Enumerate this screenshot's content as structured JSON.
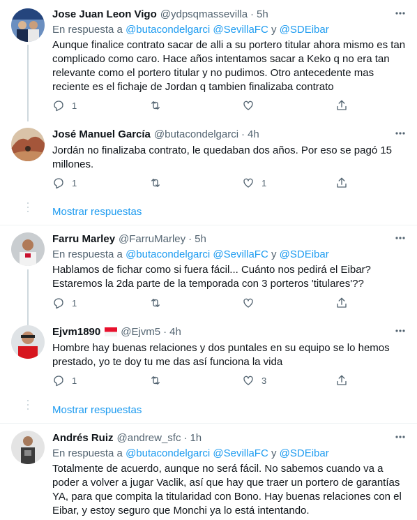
{
  "colors": {
    "link": "#1d9bf0",
    "muted": "#536471",
    "text": "#0f1419",
    "line": "#cfd9de"
  },
  "reply_prefix": "En respuesta a",
  "reply_and": "y",
  "show_replies": "Mostrar respuestas",
  "tweets": [
    {
      "name": "Jose Juan Leon Vigo",
      "handle": "@ydpsqmassevilla",
      "dot": "·",
      "time": "5h",
      "mentions": [
        "@butacondelgarci",
        "@SevillaFC",
        "@SDEibar"
      ],
      "text": [
        "Aunque finalice contrato sacar de alli a su portero titular ahora mismo es tan",
        "complicado como caro. Hace años intentamos sacar a Keko q no era tan",
        "relevante como el portero titular y no pudimos. Otro antecedente mas",
        "reciente es el fichaje de Jordan q tambien finalizaba contrato"
      ],
      "replies": "1",
      "retweets": "",
      "likes": ""
    },
    {
      "name": "José Manuel García",
      "handle": "@butacondelgarci",
      "dot": "·",
      "time": "4h",
      "text": [
        "Jordán no finalizaba contrato, le quedaban dos años. Por eso se pagó 15",
        "millones."
      ],
      "replies": "1",
      "retweets": "",
      "likes": "1"
    },
    {
      "name": "Farru Marley",
      "handle": "@FarruMarley",
      "dot": "·",
      "time": "5h",
      "mentions": [
        "@butacondelgarci",
        "@SevillaFC",
        "@SDEibar"
      ],
      "text": [
        "Hablamos de fichar como si fuera fácil... Cuánto nos pedirá el Eibar?",
        "Estaremos la 2da parte de la temporada con 3 porteros 'titulares'??"
      ],
      "replies": "1",
      "retweets": "",
      "likes": ""
    },
    {
      "name": "Ejvm1890",
      "handle": "@Ejvm5",
      "dot": "·",
      "time": "4h",
      "text": [
        "Hombre hay buenas relaciones y dos puntales en su equipo se lo hemos",
        "prestado, yo te doy tu me das así funciona la vida"
      ],
      "replies": "1",
      "retweets": "",
      "likes": "3"
    },
    {
      "name": "Andrés Ruiz",
      "handle": "@andrew_sfc",
      "dot": "·",
      "time": "1h",
      "mentions": [
        "@butacondelgarci",
        "@SevillaFC",
        "@SDEibar"
      ],
      "text": [
        "Totalmente de acuerdo, aunque no será fácil. No sabemos cuando va a",
        "poder a volver a jugar Vaclik, así que hay que traer un portero de garantías",
        "YA, para que compita la titularidad con Bono. Hay buenas relaciones con el",
        "Eibar, y estoy seguro que Monchi ya lo está intentando."
      ]
    }
  ]
}
